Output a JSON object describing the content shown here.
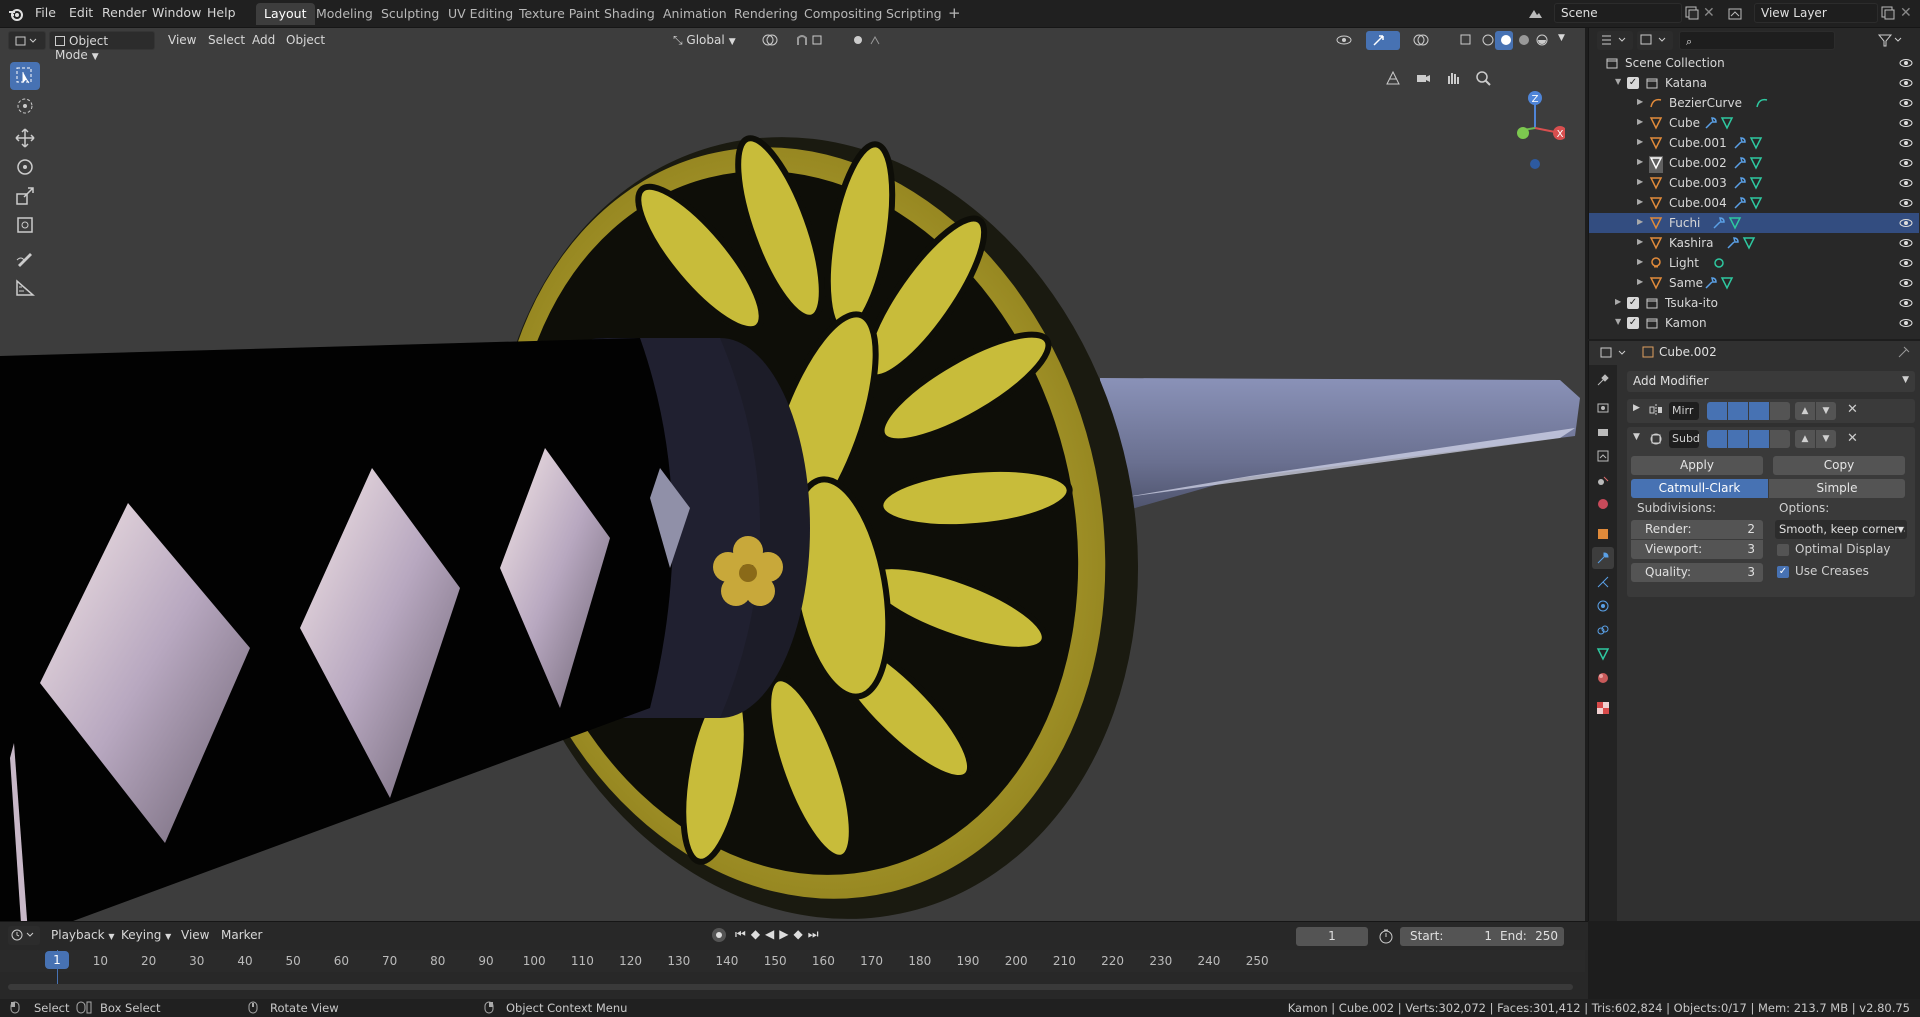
{
  "topbar": {
    "menus": [
      "File",
      "Edit",
      "Render",
      "Window",
      "Help"
    ],
    "workspaces": [
      "Layout",
      "Modeling",
      "Sculpting",
      "UV Editing",
      "Texture Paint",
      "Shading",
      "Animation",
      "Rendering",
      "Compositing",
      "Scripting"
    ],
    "active_workspace": "Layout",
    "add_tab_label": "+",
    "scene": "Scene",
    "view_layer": "View Layer"
  },
  "viewport_header": {
    "mode": "Object Mode",
    "menus": [
      "View",
      "Select",
      "Add",
      "Object"
    ],
    "transform_orientation": "Global"
  },
  "viewport": {
    "gizmo_labels": {
      "z": "Z",
      "x": "X"
    },
    "tools": [
      "select-box",
      "cursor",
      "move",
      "rotate",
      "scale",
      "transform",
      "annotate",
      "measure"
    ]
  },
  "outliner": {
    "search_placeholder": "",
    "rows": [
      {
        "label": "Scene Collection",
        "type": "scene-collection",
        "indent": 0,
        "icon": "collection-icon"
      },
      {
        "label": "Katana",
        "type": "collection",
        "indent": 1,
        "icon": "collection-icon",
        "expanded": true,
        "checked": true
      },
      {
        "label": "BezierCurve",
        "type": "curve",
        "indent": 2,
        "icon": "curve-icon"
      },
      {
        "label": "Cube",
        "type": "mesh",
        "indent": 2,
        "icon": "mesh-icon"
      },
      {
        "label": "Cube.001",
        "type": "mesh",
        "indent": 2,
        "icon": "mesh-icon"
      },
      {
        "label": "Cube.002",
        "type": "mesh",
        "indent": 2,
        "icon": "mesh-icon",
        "active": true
      },
      {
        "label": "Cube.003",
        "type": "mesh",
        "indent": 2,
        "icon": "mesh-icon"
      },
      {
        "label": "Cube.004",
        "type": "mesh",
        "indent": 2,
        "icon": "mesh-icon"
      },
      {
        "label": "Fuchi",
        "type": "mesh",
        "indent": 2,
        "icon": "mesh-icon",
        "selected": true
      },
      {
        "label": "Kashira",
        "type": "mesh",
        "indent": 2,
        "icon": "mesh-icon"
      },
      {
        "label": "Light",
        "type": "light",
        "indent": 2,
        "icon": "light-icon"
      },
      {
        "label": "Same",
        "type": "mesh",
        "indent": 2,
        "icon": "mesh-icon"
      },
      {
        "label": "Tsuka-ito",
        "type": "collection",
        "indent": 1,
        "icon": "collection-icon",
        "checked": true
      },
      {
        "label": "Kamon",
        "type": "collection",
        "indent": 1,
        "icon": "collection-icon",
        "checked": true,
        "expanded": true
      }
    ]
  },
  "properties": {
    "object_name": "Cube.002",
    "add_modifier": "Add Modifier",
    "modifiers": [
      {
        "name": "Mirr",
        "expanded": false
      },
      {
        "name": "Subd",
        "expanded": true
      }
    ],
    "apply_label": "Apply",
    "copy_label": "Copy",
    "subdiv_types": [
      "Catmull-Clark",
      "Simple"
    ],
    "active_subdiv_type": "Catmull-Clark",
    "subdivisions_label": "Subdivisions:",
    "options_label": "Options:",
    "render_label": "Render:",
    "render_value": "2",
    "viewport_label": "Viewport:",
    "viewport_value": "3",
    "quality_label": "Quality:",
    "quality_value": "3",
    "uv_smooth": "Smooth, keep corners",
    "optimal_display_label": "Optimal Display",
    "optimal_display": false,
    "use_creases_label": "Use Creases",
    "use_creases": true
  },
  "timeline": {
    "menus": [
      "Playback",
      "Keying",
      "View",
      "Marker"
    ],
    "current_frame": "1",
    "start_label": "Start:",
    "start": "1",
    "end_label": "End:",
    "end": "250",
    "ruler_current": "1",
    "ruler_ticks": [
      "10",
      "20",
      "30",
      "40",
      "50",
      "60",
      "70",
      "80",
      "90",
      "100",
      "110",
      "120",
      "130",
      "140",
      "150",
      "160",
      "170",
      "180",
      "190",
      "200",
      "210",
      "220",
      "230",
      "240",
      "250"
    ]
  },
  "statusbar": {
    "select": "Select",
    "box_select": "Box Select",
    "rotate_view": "Rotate View",
    "context_menu": "Object Context Menu",
    "stats": "Kamon | Cube.002 | Verts:302,072 | Faces:301,412 | Tris:602,824 | Objects:0/17 | Mem: 213.7 MB | v2.80.75"
  },
  "colors": {
    "accent": "#4772b3",
    "selected_row": "#334d80",
    "viewport_bg": "#3d3d3d",
    "gold": "#b8a82a",
    "mesh_icon": "#e08a3a",
    "modifier_icon": "#5aa0e6",
    "data_icon": "#2ec8a0"
  }
}
